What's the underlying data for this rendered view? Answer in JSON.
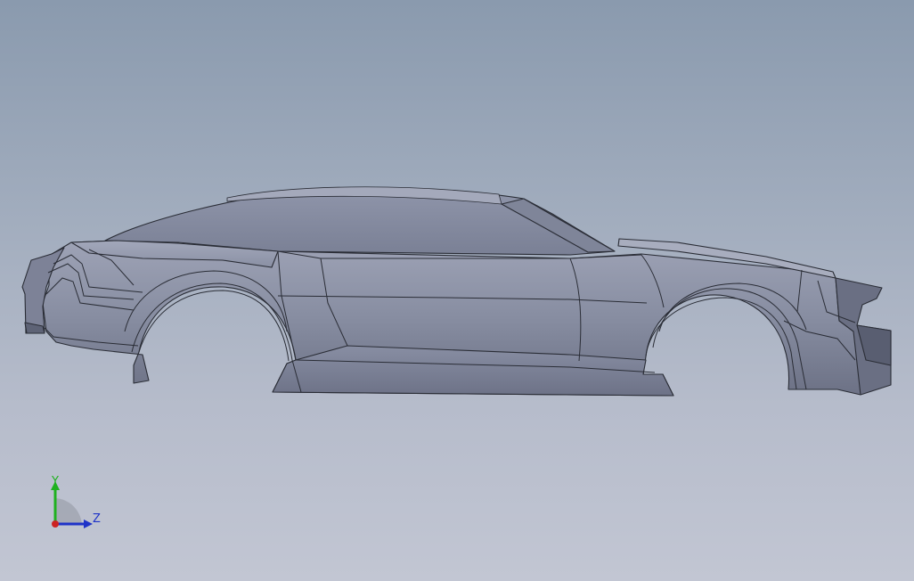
{
  "viewport": {
    "background_top": "#8a9aae",
    "background_bottom": "#c2c6d3"
  },
  "model": {
    "body_color": "#8a90a4",
    "edge_color": "#2a2d36"
  },
  "triad": {
    "y_label": "Y",
    "z_label": "Z",
    "y_color": "#1fb11f",
    "z_color": "#1f33c8",
    "x_color": "#cc2222"
  }
}
